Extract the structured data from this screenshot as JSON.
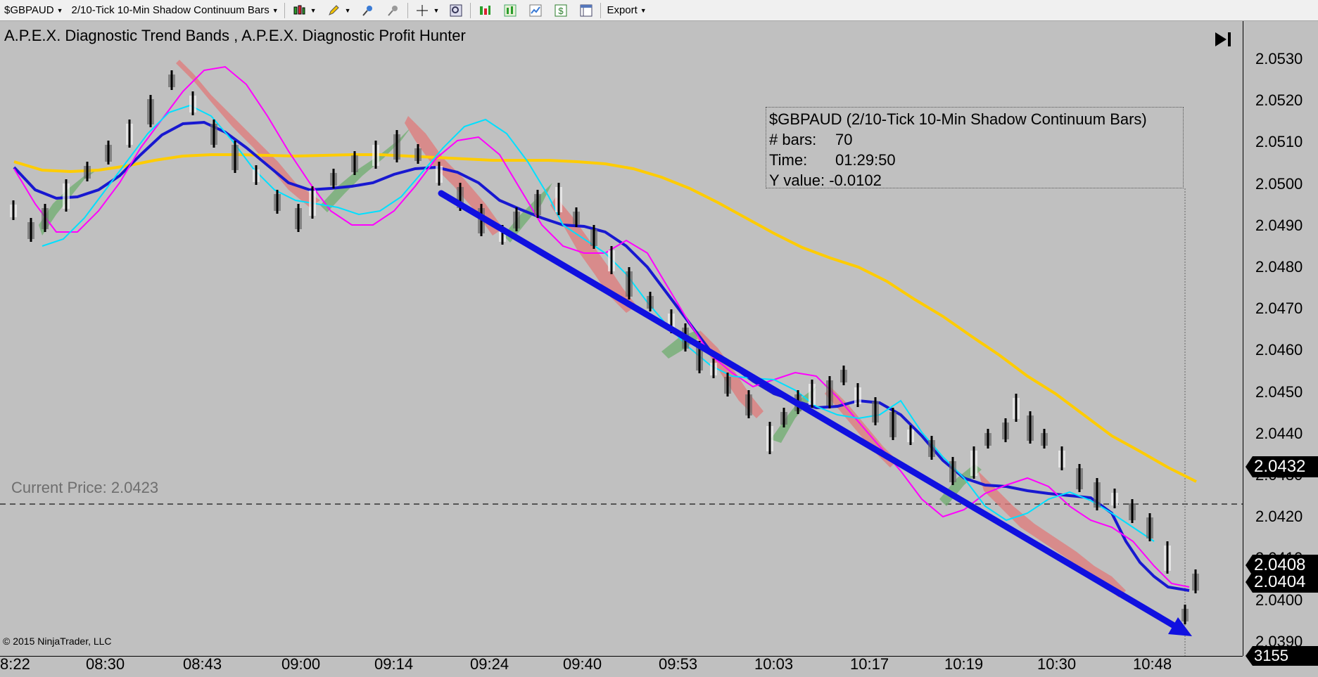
{
  "toolbar": {
    "instrument": "$GBPAUD",
    "bar_type": "2/10-Tick 10-Min Shadow Continuum Bars",
    "export_label": "Export"
  },
  "chart": {
    "title": "A.P.E.X. Diagnostic Trend Bands , A.P.E.X. Diagnostic Profit Hunter",
    "current_price_text": "Current Price: 2.0423",
    "copyright": "© 2015 NinjaTrader, LLC",
    "databox": {
      "line1": "$GBPAUD (2/10-Tick 10-Min Shadow Continuum Bars)",
      "bars_label": "# bars:",
      "bars_value": "70",
      "time_label": "Time:",
      "time_value": "01:29:50",
      "y_label": "Y value:",
      "y_value": "-0.0102"
    },
    "price_flags": {
      "ma_slow": "2.0432",
      "last": "2.0408",
      "second": "2.0404",
      "bar_count": "3155"
    },
    "price_ticks": [
      "2.0530",
      "2.0520",
      "2.0510",
      "2.0500",
      "2.0490",
      "2.0480",
      "2.0470",
      "2.0460",
      "2.0450",
      "2.0440",
      "2.0430",
      "2.0420",
      "2.0410",
      "2.0400",
      "2.0390"
    ],
    "time_ticks": [
      "8:22",
      "08:30",
      "08:43",
      "09:00",
      "09:14",
      "09:24",
      "09:40",
      "09:53",
      "10:03",
      "10:17",
      "10:19",
      "10:30",
      "10:48"
    ],
    "colors": {
      "background": "#c0c0c0",
      "ma_slow": "#ffcc00",
      "ma_blue": "#1818d0",
      "ma_magenta": "#ff00ff",
      "ma_cyan": "#00e0ff",
      "band_up": "#6fae6f",
      "band_down": "#e07a7a",
      "trend_arrow": "#1010e0"
    }
  }
}
